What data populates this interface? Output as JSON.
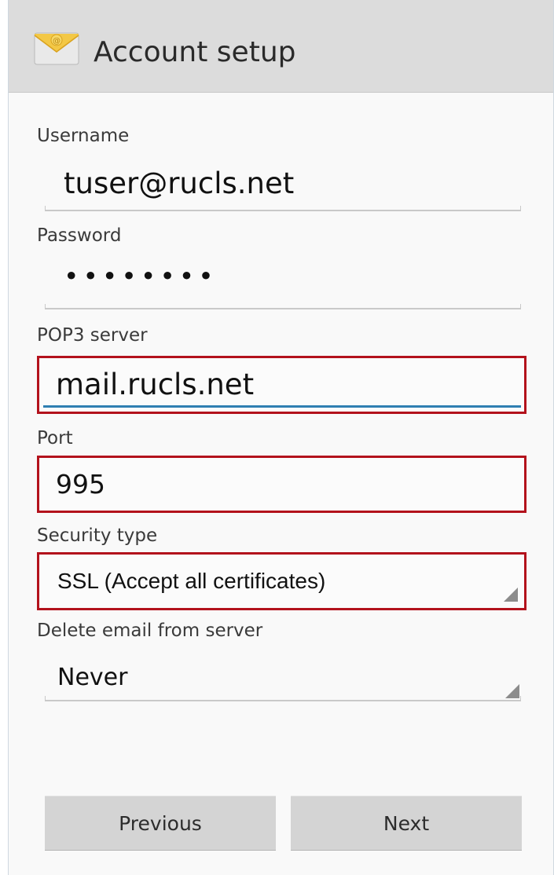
{
  "header": {
    "title": "Account setup",
    "icon": "email-app-icon"
  },
  "form": {
    "username": {
      "label": "Username",
      "value": "tuser@rucls.net"
    },
    "password": {
      "label": "Password",
      "value": "••••••••"
    },
    "pop3_server": {
      "label": "POP3 server",
      "value": "mail.rucls.net"
    },
    "port": {
      "label": "Port",
      "value": "995"
    },
    "security_type": {
      "label": "Security type",
      "value": "SSL (Accept all certificates)"
    },
    "delete_email": {
      "label": "Delete email from server",
      "value": "Never"
    }
  },
  "buttons": {
    "previous": "Previous",
    "next": "Next"
  },
  "colors": {
    "highlight": "#b3121c",
    "accent": "#2f7fb2",
    "header_bg": "#dcdcdc",
    "button_bg": "#d4d4d4"
  }
}
